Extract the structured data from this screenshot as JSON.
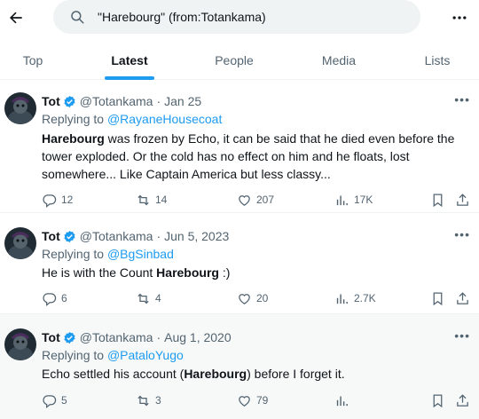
{
  "search": {
    "query": "\"Harebourg\" (from:Totankama)"
  },
  "tabs": [
    {
      "label": "Top"
    },
    {
      "label": "Latest"
    },
    {
      "label": "People"
    },
    {
      "label": "Media"
    },
    {
      "label": "Lists"
    }
  ],
  "active_tab": "Latest",
  "accent_color": "#1d9bf0",
  "tweets": [
    {
      "name": "Tot",
      "handle": "@Totankama",
      "sep": "·",
      "date": "Jan 25",
      "reply_prefix": "Replying to",
      "reply_to": "@RayaneHousecoat",
      "text_bold": "Harebourg",
      "text_rest": " was frozen by Echo, it can be said that he died even before the tower exploded. Or the cold has no effect on him and he floats, lost somewhere... Like Captain America but less classy...",
      "replies": "12",
      "retweets": "14",
      "likes": "207",
      "views": "17K"
    },
    {
      "name": "Tot",
      "handle": "@Totankama",
      "sep": "·",
      "date": "Jun 5, 2023",
      "reply_prefix": "Replying to",
      "reply_to": "@BgSinbad",
      "text_before": "He is with the Count ",
      "text_bold": "Harebourg",
      "text_after": " :)",
      "replies": "6",
      "retweets": "4",
      "likes": "20",
      "views": "2.7K"
    },
    {
      "name": "Tot",
      "handle": "@Totankama",
      "sep": "·",
      "date": "Aug 1, 2020",
      "reply_prefix": "Replying to",
      "reply_to": "@PataloYugo",
      "text_before": "Echo settled his account (",
      "text_bold": "Harebourg",
      "text_after": ") before I forget it.",
      "replies": "5",
      "retweets": "3",
      "likes": "79"
    }
  ]
}
